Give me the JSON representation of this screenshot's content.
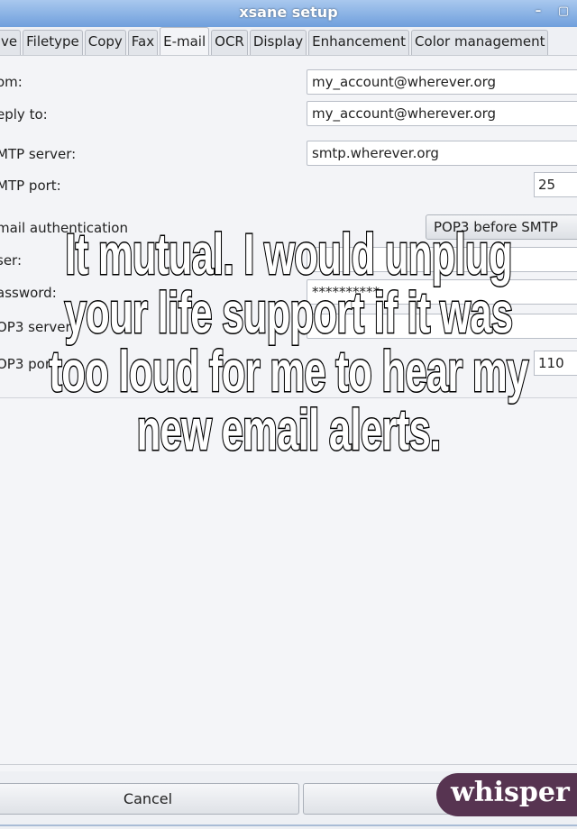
{
  "window": {
    "title": "xsane setup"
  },
  "tabs": [
    "ve",
    "Filetype",
    "Copy",
    "Fax",
    "E-mail",
    "OCR",
    "Display",
    "Enhancement",
    "Color management"
  ],
  "active_tab": "E-mail",
  "form": {
    "from_label": "om:",
    "from_value": "my_account@wherever.org",
    "reply_label": "eply to:",
    "reply_value": "my_account@wherever.org",
    "smtp_server_label": "MTP server:",
    "smtp_server_value": "smtp.wherever.org",
    "smtp_port_label": "MTP port:",
    "smtp_port_value": "25",
    "auth_label": "mail authentication",
    "auth_value": "POP3 before SMTP",
    "user_label": "ser:",
    "user_value": "",
    "password_label": "assword:",
    "password_value": "**********",
    "pop3_server_label": "OP3 server:",
    "pop3_server_value": "",
    "pop3_port_label": "OP3 port:",
    "pop3_port_value": "110"
  },
  "buttons": {
    "cancel": "Cancel",
    "ok": ""
  },
  "overlay_text": "It mutual. I would unplug your life support if it was too loud for me to hear my new email alerts.",
  "brand": {
    "label": "whisper",
    "color": "#573451"
  }
}
